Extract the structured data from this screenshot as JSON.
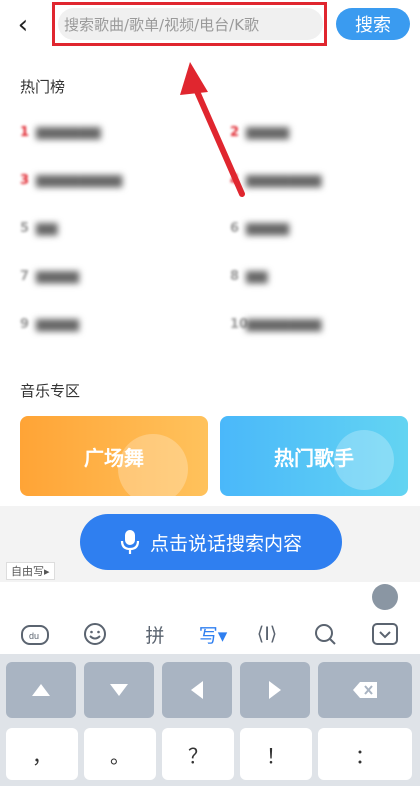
{
  "header": {
    "back_icon": "chevron-left-icon",
    "search_placeholder": "搜索歌曲/歌单/视频/电台/K歌",
    "search_button": "搜索"
  },
  "hot": {
    "title": "热门榜"
  },
  "music_zone": {
    "title": "音乐专区",
    "cards": [
      "广场舞",
      "热门歌手"
    ]
  },
  "voice": {
    "button_label": "点击说话搜索内容",
    "free_tag": "自由写▸"
  },
  "keyboard": {
    "tools": [
      "du-icon",
      "emoji-icon",
      "拼",
      "写▾",
      "cursor-icon",
      "search-icon",
      "collapse-icon"
    ],
    "row_func": [
      "up-arrow",
      "down-arrow",
      "left-arrow",
      "right-arrow",
      "backspace-icon"
    ],
    "row_chars": [
      "，",
      "。",
      "？",
      "！",
      "："
    ]
  },
  "colors": {
    "accent": "#3a9bf0",
    "highlight": "#e0262f",
    "voice": "#2f7ff0"
  }
}
